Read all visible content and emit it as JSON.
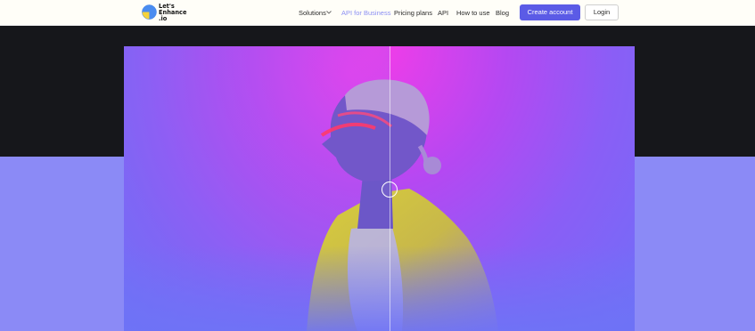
{
  "header": {
    "logo_text": "Let's\nEnhance\n.io",
    "nav": {
      "solutions": "Solutions",
      "api_business": "API for Business",
      "pricing": "Pricing plans",
      "api": "API",
      "how_to": "How to use",
      "blog": "Blog"
    },
    "create_account": "Create account",
    "login": "Login"
  },
  "hero": {
    "comparison_slider_position": 0.52
  },
  "colors": {
    "accent": "#5b5be6",
    "active_nav": "#8b8ff3",
    "dark_band": "#16171b",
    "purple_band": "#8b8af6"
  }
}
